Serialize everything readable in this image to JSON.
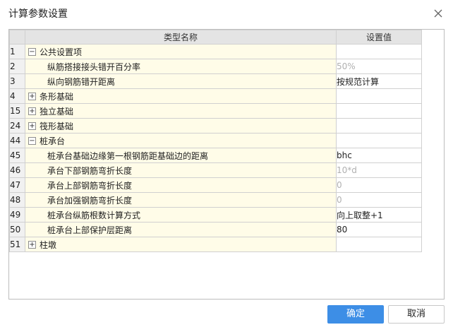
{
  "window": {
    "title": "计算参数设置"
  },
  "table": {
    "headers": [
      "类型名称",
      "设置值"
    ],
    "rows": [
      {
        "num": "1",
        "name": "公共设置项",
        "value": "",
        "toggle": "−",
        "child": false,
        "muted": false
      },
      {
        "num": "2",
        "name": "纵筋搭接接头错开百分率",
        "value": "50%",
        "toggle": "",
        "child": true,
        "muted": true
      },
      {
        "num": "3",
        "name": "纵向钢筋错开距离",
        "value": "按规范计算",
        "toggle": "",
        "child": true,
        "muted": false
      },
      {
        "num": "4",
        "name": "条形基础",
        "value": "",
        "toggle": "+",
        "child": false,
        "muted": false
      },
      {
        "num": "15",
        "name": "独立基础",
        "value": "",
        "toggle": "+",
        "child": false,
        "muted": false
      },
      {
        "num": "24",
        "name": "筏形基础",
        "value": "",
        "toggle": "+",
        "child": false,
        "muted": false
      },
      {
        "num": "44",
        "name": "桩承台",
        "value": "",
        "toggle": "−",
        "child": false,
        "muted": false
      },
      {
        "num": "45",
        "name": "桩承台基础边缘第一根钢筋距基础边的距离",
        "value": "bhc",
        "toggle": "",
        "child": true,
        "muted": false
      },
      {
        "num": "46",
        "name": "承台下部钢筋弯折长度",
        "value": "10*d",
        "toggle": "",
        "child": true,
        "muted": true
      },
      {
        "num": "47",
        "name": "承台上部钢筋弯折长度",
        "value": "0",
        "toggle": "",
        "child": true,
        "muted": true
      },
      {
        "num": "48",
        "name": "承台加强钢筋弯折长度",
        "value": "0",
        "toggle": "",
        "child": true,
        "muted": true
      },
      {
        "num": "49",
        "name": "桩承台纵筋根数计算方式",
        "value": "向上取整+1",
        "toggle": "",
        "child": true,
        "muted": false
      },
      {
        "num": "50",
        "name": "桩承台上部保护层距离",
        "value": "80",
        "toggle": "",
        "child": true,
        "muted": false
      },
      {
        "num": "51",
        "name": "柱墩",
        "value": "",
        "toggle": "+",
        "child": false,
        "muted": false
      }
    ]
  },
  "buttons": {
    "ok": "确定",
    "cancel": "取消"
  },
  "icons": {
    "close": "close-icon",
    "expand": "plus-box-icon",
    "collapse": "minus-box-icon"
  },
  "colors": {
    "primary": "#3d8ee6",
    "name_cell_bg": "#fffce8",
    "header_bg": "#e4e4e4"
  }
}
